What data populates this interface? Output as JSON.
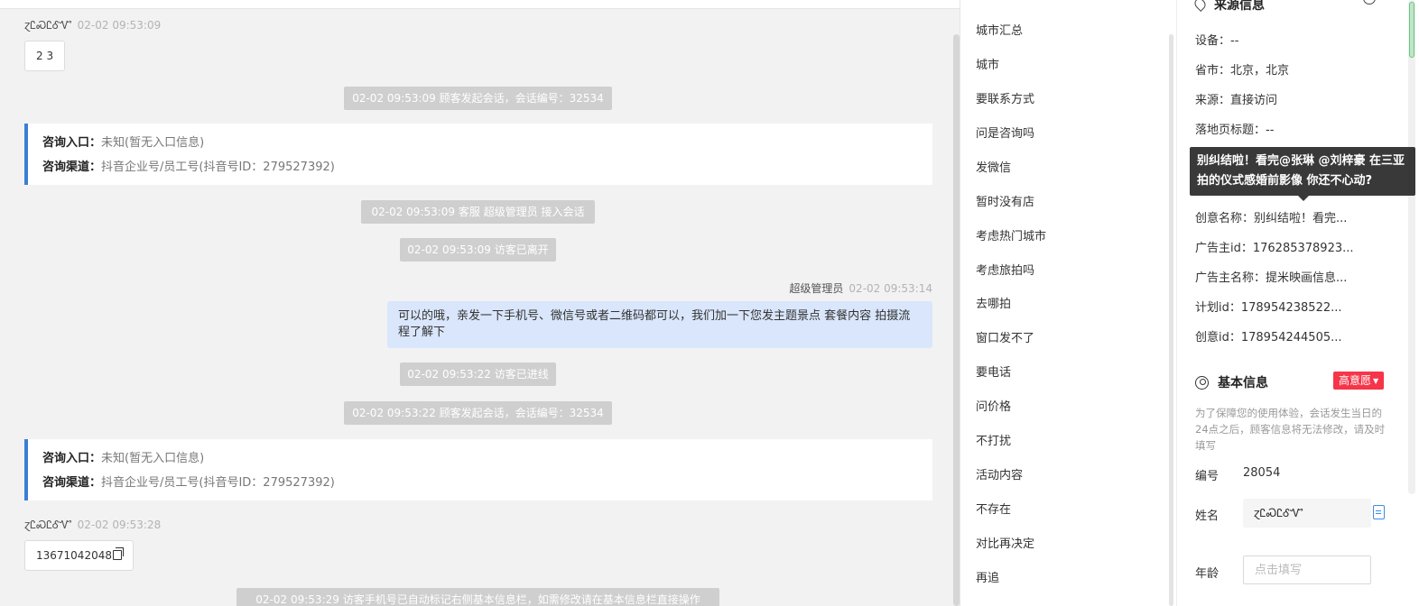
{
  "chat": {
    "visitor_name": "ɀᏝᏍᏝᎴᏉ",
    "messages": [
      {
        "time": "02-02 09:53:09",
        "text": "2 3"
      },
      {
        "time": "02-02 09:53:28",
        "text": "13671042048"
      }
    ],
    "system_notes": [
      "02-02 09:53:09 顾客发起会话，会话编号：32534",
      "02-02 09:53:09 客服 超级管理员 接入会话",
      "02-02 09:53:09 访客已离开",
      "02-02 09:53:22 访客已进线",
      "02-02 09:53:22 顾客发起会话，会话编号：32534",
      "02-02 09:53:29 访客手机号已自动标记右侧基本信息栏，如需修改请在基本信息栏直接操作"
    ],
    "entry_cards": [
      {
        "entry_label": "咨询入口：",
        "entry_value": "未知(暂无入口信息)",
        "channel_label": "咨询渠道：",
        "channel_value": "抖音企业号/员工号(抖音号ID：279527392)"
      },
      {
        "entry_label": "咨询入口：",
        "entry_value": "未知(暂无入口信息)",
        "channel_label": "咨询渠道：",
        "channel_value": "抖音企业号/员工号(抖音号ID：279527392)"
      }
    ],
    "agent_message": {
      "name": "超级管理员",
      "time": "02-02 09:53:14",
      "text": "可以的哦，亲发一下手机号、微信号或者二维码都可以，我们加一下您发主题景点 套餐内容 拍摄流程了解下"
    }
  },
  "quick_replies": [
    "城市汇总",
    "城市",
    "要联系方式",
    "问是咨询吗",
    "发微信",
    "暂时没有店",
    "考虑热门城市",
    "考虑旅拍吗",
    "去哪拍",
    "窗口发不了",
    "要电话",
    "问价格",
    "不打扰",
    "活动内容",
    "不存在",
    "对比再决定",
    "再追"
  ],
  "source_info": {
    "title": "来源信息",
    "device": "设备：--",
    "province_city": "省市：北京，北京",
    "source": "来源：直接访问",
    "landing_title": "落地页标题：--",
    "creative_name": "创意名称：别纠结啦！看完...",
    "advertiser_id": "广告主id：176285378923...",
    "advertiser_name": "广告主名称：提米映画信息...",
    "plan_id": "计划id：178954238522...",
    "creative_id": "创意id：178954244505...",
    "tooltip": "别纠结啦！看完@张琳 @刘梓豪 在三亚拍的仪式感婚前影像 你还不心动?"
  },
  "basic_info": {
    "title": "基本信息",
    "intent_badge": "高意愿",
    "notice": "为了保障您的使用体验，会话发生当日的24点之后，顾客信息将无法修改，请及时填写",
    "id_label": "编号",
    "id_value": "28054",
    "name_label": "姓名",
    "name_value": "ɀᏝᏍᏝᎴᏉ",
    "age_label": "年龄",
    "age_placeholder": "点击填写"
  }
}
